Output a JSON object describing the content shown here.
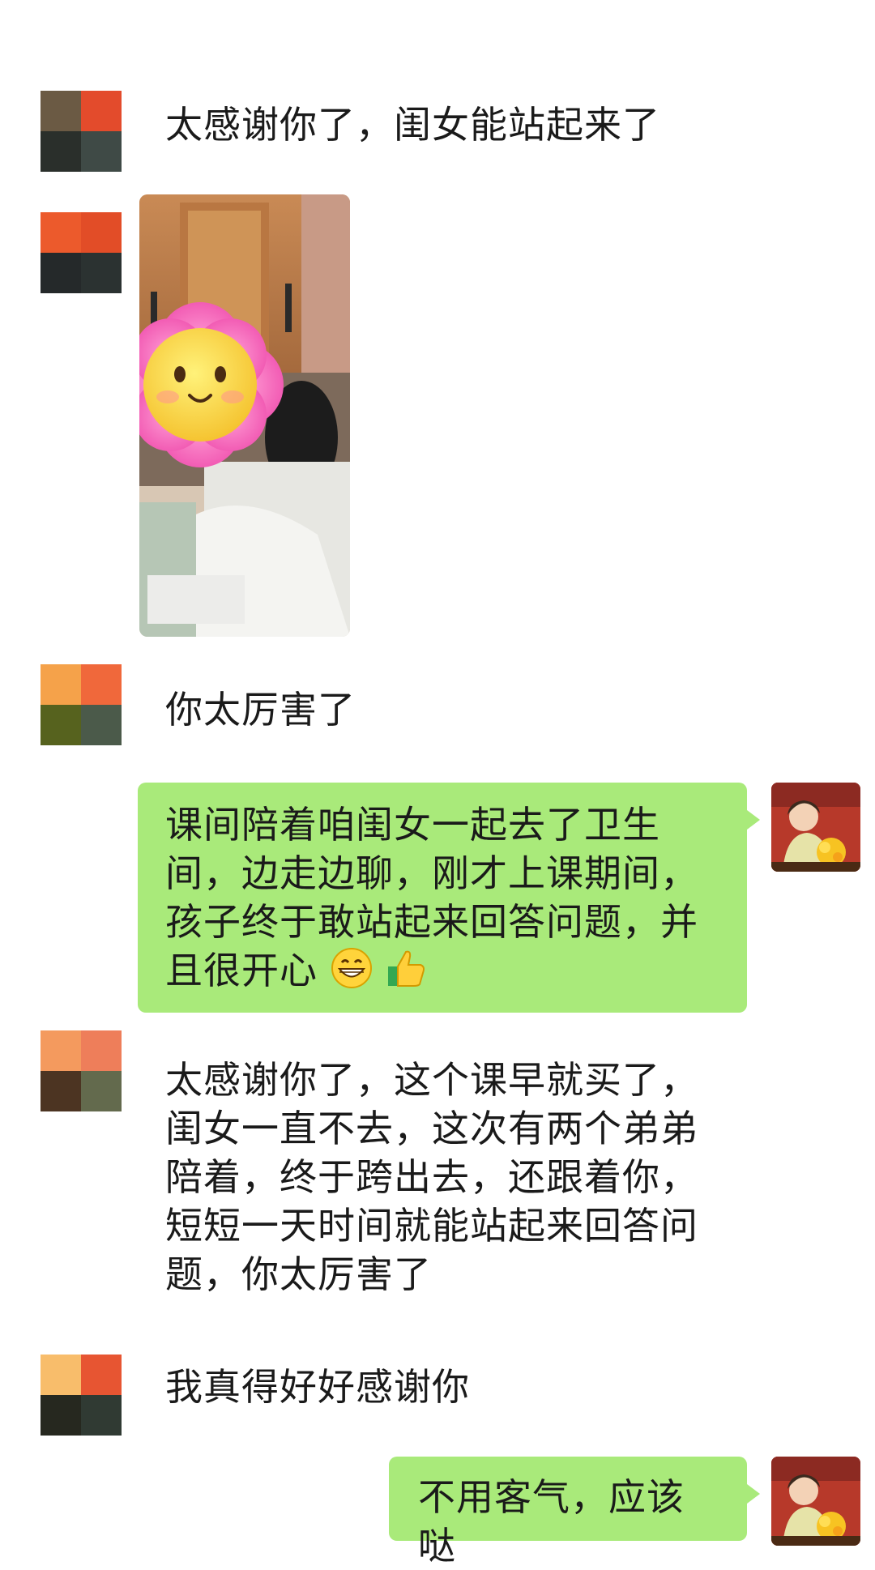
{
  "messages": [
    {
      "id": "m1",
      "side": "left",
      "type": "text",
      "text": "太感谢你了，闺女能站起来了",
      "avatar_colors": [
        "#6b5a44",
        "#e34b2c",
        "#2a2f2b",
        "#3f4a46"
      ]
    },
    {
      "id": "m2",
      "side": "left",
      "type": "image",
      "avatar_colors": [
        "#ec5a2c",
        "#e24d27",
        "#25292a",
        "#2b3231"
      ],
      "image_description_icon": "flower-smiley-sticker-icon"
    },
    {
      "id": "m3",
      "side": "left",
      "type": "text",
      "text": "你太厉害了",
      "avatar_colors": [
        "#f5a24a",
        "#f0683b",
        "#56621e",
        "#4b5a4a"
      ]
    },
    {
      "id": "m4",
      "side": "right",
      "type": "text",
      "text": "课间陪着咱闺女一起去了卫生间，边走边聊，刚才上课期间，孩子终于敢站起来回答问题，并且很开心",
      "emojis": [
        "grin-icon",
        "thumbs-up-icon"
      ]
    },
    {
      "id": "m5",
      "side": "left",
      "type": "text",
      "text": "太感谢你了，这个课早就买了，闺女一直不去，这次有两个弟弟陪着，终于跨出去，还跟着你，短短一天时间就能站起来回答问题，你太厉害了",
      "avatar_colors": [
        "#f49a5e",
        "#ee7e5a",
        "#4c3422",
        "#636a4d"
      ]
    },
    {
      "id": "m6",
      "side": "left",
      "type": "text",
      "text": "我真得好好感谢你",
      "avatar_colors": [
        "#f8bd6b",
        "#e75532",
        "#26281f",
        "#303a33"
      ]
    },
    {
      "id": "m7",
      "side": "right",
      "type": "text",
      "text": "不用客气，应该哒"
    }
  ],
  "colors": {
    "bubble_green": "#a9ea7a",
    "background": "#ffffff",
    "text": "#1a1a1a"
  }
}
